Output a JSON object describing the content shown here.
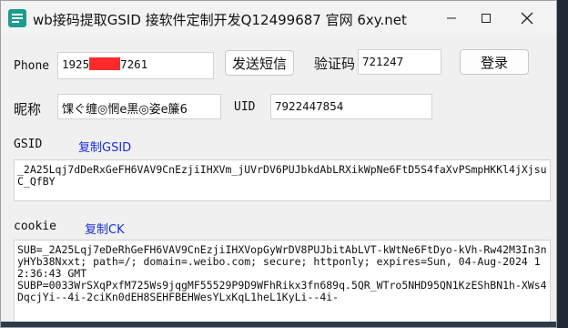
{
  "window": {
    "title": "wb接码提取GSID 接软件定制开发Q12499687 官网 6xy.net"
  },
  "form": {
    "phone_label": "Phone",
    "phone_prefix": "1925",
    "phone_suffix": "7261",
    "send_sms_label": "发送短信",
    "code_label": "验证码",
    "code_value": "721247",
    "login_label": "登录",
    "nick_label": "昵称",
    "nick_value": "馃ぐ缠◎惘e黒◎姿e簾6",
    "uid_label": "UID",
    "uid_value": "7922447854",
    "gsid_label": "GSID",
    "copy_gsid_label": "复制GSID",
    "gsid_value": "_2A25Lqj7dDeRxGeFH6VAV9CnEzjiIHXVm_jUVrDV6PUJbkdAbLRXikWpNe6FtD5S4faXvPSmpHKKl4jXjsuC_QfBY",
    "cookie_label": "cookie",
    "copy_ck_label": "复制CK",
    "cookie_value": "SUB=_2A25Lqj7eDeRhGeFH6VAV9CnEzjiIHXVopGyWrDV8PUJbitAbLVT-kWtNe6FtDyo-kVh-Rw42M3In3nyHYb38Nxxt; path=/; domain=.weibo.com; secure; httponly; expires=Sun, 04-Aug-2024 12:36:43 GMT\nSUBP=0033WrSXqPxfM725Ws9jqgMF55529P9D9WFhRikx3fn689q.5QR_WTro5NHD95QN1KzEShBN1h-XWs4DqcjYi--4i-2ciKn0dEH8SEHFBEHWesYLxKqL1heL1KyLi--4i-"
  }
}
